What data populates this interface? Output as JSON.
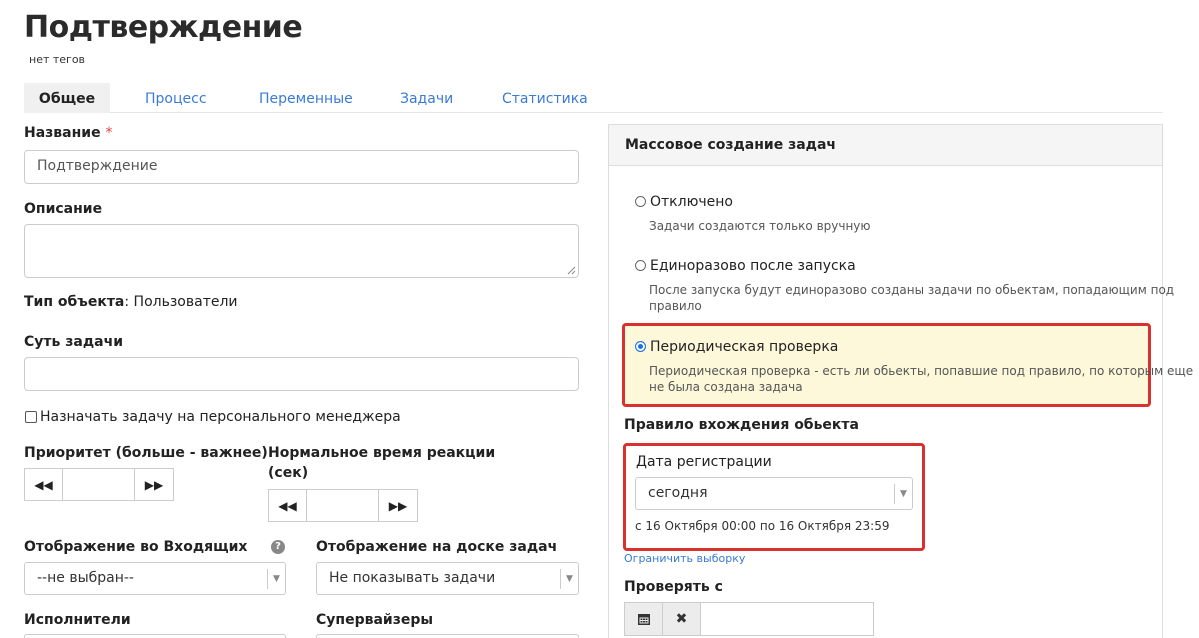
{
  "page": {
    "title": "Подтверждение",
    "tags": "нет тегов"
  },
  "tabs": [
    {
      "label": "Общее"
    },
    {
      "label": "Процесс"
    },
    {
      "label": "Переменные"
    },
    {
      "label": "Задачи"
    },
    {
      "label": "Статистика"
    }
  ],
  "form": {
    "name_label": "Название",
    "name_required": "*",
    "name_value": "Подтверждение",
    "description_label": "Описание",
    "description_value": "",
    "object_type_label": "Тип объекта",
    "object_type_value": ": Пользователи",
    "essence_label": "Суть задачи",
    "essence_value": "",
    "assign_manager_label": "Назначать задачу на персонального менеджера",
    "priority_label": "Приоритет (больше - важнее)",
    "priority_value": "",
    "reaction_time_label_1": "Нормальное время реакции",
    "reaction_time_label_2": "(сек)",
    "reaction_time_value": "",
    "inbox_display_label": "Отображение во Входящих",
    "inbox_display_value": "--не выбран--",
    "board_display_label": "Отображение на доске задач",
    "board_display_value": "Не показывать задачи",
    "executors_label": "Исполнители",
    "supervisors_label": "Супервайзеры"
  },
  "mass": {
    "heading": "Массовое создание задач",
    "options": [
      {
        "label": "Отключено",
        "desc": "Задачи создаются только вручную",
        "selected": false
      },
      {
        "label": "Единоразово после запуска",
        "desc_1": "После запуска будут единоразово созданы задачи по обьектам, попадающим под",
        "desc_2": "правило",
        "selected": false
      },
      {
        "label": "Периодическая проверка",
        "desc_1": "Периодическая проверка - есть ли обьекты, попавшие под правило, по которым еще",
        "desc_2": "не была создана задача",
        "selected": true
      }
    ],
    "rule_heading": "Правило вхождения обьекта",
    "rule_field_label": "Дата регистрации",
    "rule_select_value": "сегодня",
    "rule_range": "с 16 Октября 00:00 по 16 Октября 23:59",
    "limit_link": "Ограничить выборку",
    "check_from_label": "Проверять с",
    "check_from_value": ""
  },
  "icons": {
    "rewind": "rewind-icon",
    "forward": "fast-forward-icon",
    "help": "question-circle-icon",
    "calendar": "calendar-icon",
    "clear": "close-icon",
    "caret": "chevron-down-icon"
  },
  "colors": {
    "accent": "#3a7bd5",
    "highlight_border": "#d93030",
    "highlight_bg": "#fcf8d9",
    "required": "#e44444",
    "radio_selected": "#1a6fe8"
  }
}
